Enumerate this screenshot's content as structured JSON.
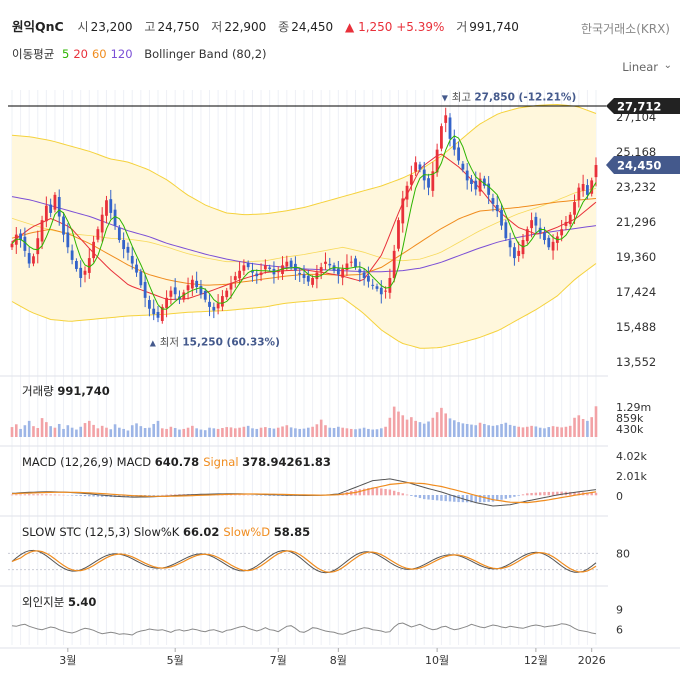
{
  "header": {
    "name": "원익QnC",
    "open_label": "시",
    "open": "23,200",
    "high_label": "고",
    "high": "24,750",
    "low_label": "저",
    "low": "22,900",
    "close_label": "종",
    "close": "24,450",
    "change": "▲ 1,250 +5.39%",
    "volume_label": "거",
    "volume": "991,740",
    "exchange": "한국거래소(KRX)",
    "scale": "Linear"
  },
  "indicators": {
    "ma_label": "이동평균",
    "ma_periods": [
      {
        "label": "5",
        "color": "#2db400"
      },
      {
        "label": "20",
        "color": "#e8303a"
      },
      {
        "label": "60",
        "color": "#f08c1e"
      },
      {
        "label": "120",
        "color": "#7b4fd6"
      }
    ],
    "bb_label": "Bollinger Band (80,2)"
  },
  "colors": {
    "up": "#e8303a",
    "down": "#3463c9",
    "bb_line": "#f5d23c",
    "bb_fill": "#fff7dc",
    "ma5": "#2db400",
    "ma20": "#e8303a",
    "ma60": "#f08c1e",
    "ma120": "#7b4fd6",
    "macd": "#555555",
    "signal": "#f08c1e",
    "stc_k": "#555555",
    "stc_d": "#f08c1e"
  },
  "chart_data": {
    "type": "line",
    "price_axis": {
      "ylim": [
        13552,
        28600
      ],
      "ticks": [
        13552,
        15488,
        17424,
        19360,
        21296,
        23232,
        25168,
        27104
      ],
      "tick_labels": [
        "13,552",
        "15,488",
        "17,424",
        "19,360",
        "21,296",
        "23,232",
        "25,168",
        "27,104"
      ]
    },
    "x_axis": {
      "ticks": [
        {
          "label": "3월",
          "index": 13
        },
        {
          "label": "5월",
          "index": 38
        },
        {
          "label": "7월",
          "index": 62
        },
        {
          "label": "8월",
          "index": 76
        },
        {
          "label": "10월",
          "index": 99
        },
        {
          "label": "12월",
          "index": 122
        },
        {
          "label": "2026",
          "index": 135
        }
      ]
    },
    "close_series": [
      20100,
      20600,
      20300,
      19700,
      19000,
      19400,
      20400,
      21400,
      22200,
      21800,
      22800,
      21600,
      20600,
      19900,
      19200,
      18700,
      18200,
      18600,
      19300,
      20200,
      20900,
      21700,
      22500,
      21800,
      21100,
      20300,
      19800,
      19600,
      19000,
      18500,
      17800,
      17100,
      16500,
      16200,
      16000,
      16600,
      17100,
      17500,
      17300,
      17000,
      17400,
      17800,
      18100,
      17700,
      17300,
      17000,
      16600,
      16400,
      16800,
      17200,
      17500,
      17900,
      18300,
      18600,
      18900,
      18800,
      18500,
      18300,
      18500,
      18900,
      18700,
      18400,
      18600,
      18900,
      19100,
      18800,
      18600,
      18400,
      18200,
      18000,
      18200,
      18500,
      18800,
      19100,
      18900,
      18600,
      18400,
      18700,
      19000,
      19100,
      18800,
      18500,
      18200,
      18000,
      17800,
      17600,
      17300,
      17500,
      18200,
      19700,
      21400,
      22600,
      23300,
      23900,
      24600,
      24200,
      23600,
      23200,
      24100,
      25300,
      26600,
      27200,
      25900,
      25300,
      24700,
      24200,
      23600,
      23400,
      23100,
      23700,
      23300,
      22800,
      22300,
      21900,
      21100,
      20400,
      19900,
      19300,
      19700,
      20300,
      20900,
      21400,
      21100,
      20700,
      20300,
      19900,
      20200,
      20500,
      20900,
      21300,
      21700,
      22400,
      23200,
      23400,
      22800,
      23600,
      24450
    ],
    "bb_upper": [
      26100,
      26000,
      25800,
      25500,
      25200,
      24800,
      24600,
      24200,
      23600,
      22800,
      22200,
      21800,
      21700,
      21750,
      21900,
      22100,
      22400,
      22700,
      23000,
      23300,
      23700,
      24200,
      24900,
      25800,
      26700,
      27300,
      27600,
      27750,
      27800,
      27700,
      27300
    ],
    "bb_lower": [
      16900,
      16300,
      15900,
      15800,
      15900,
      16000,
      16100,
      16150,
      16200,
      16300,
      16350,
      16400,
      16500,
      16600,
      16800,
      16900,
      17000,
      17100,
      16300,
      15300,
      14600,
      14300,
      14350,
      14600,
      14900,
      15300,
      15900,
      16500,
      17200,
      18200,
      19000
    ],
    "bb_mid": [
      21500,
      21150,
      20850,
      20650,
      20550,
      20400,
      20350,
      20200,
      19900,
      19550,
      19300,
      19100,
      19100,
      19150,
      19350,
      19500,
      19700,
      19900,
      19650,
      19300,
      19150,
      19250,
      19600,
      20200,
      20800,
      21300,
      21750,
      22100,
      22500,
      22950,
      23150
    ],
    "ma120": [
      22700,
      22500,
      22200,
      21900,
      21600,
      21200,
      20800,
      20500,
      20100,
      19800,
      19500,
      19250,
      19050,
      18900,
      18800,
      18700,
      18650,
      18600,
      18550,
      18550,
      18600,
      18750,
      19050,
      19450,
      19850,
      20200,
      20450,
      20650,
      20800,
      20950,
      21100
    ],
    "ma60": [
      20400,
      20700,
      20900,
      20600,
      20100,
      19500,
      18900,
      18400,
      18100,
      17900,
      17800,
      17850,
      18000,
      18150,
      18300,
      18400,
      18400,
      18350,
      18400,
      18800,
      19500,
      20200,
      20900,
      21500,
      21900,
      22000,
      22100,
      22250,
      22400,
      22500,
      22600
    ],
    "ma20": [
      20200,
      21000,
      21500,
      21000,
      19800,
      18700,
      17800,
      17400,
      17000,
      17050,
      17400,
      17800,
      18200,
      18500,
      18600,
      18650,
      18500,
      18300,
      18000,
      19500,
      22200,
      24300,
      25100,
      24300,
      23200,
      21900,
      21000,
      20600,
      21000,
      21500,
      22400
    ],
    "highs_lows": {
      "high": {
        "label": "최고",
        "value": "27,850 (-12.21%)",
        "price": 27850,
        "index": 101
      },
      "low": {
        "label": "최저",
        "value": "15,250 (60.33%)",
        "price": 15250,
        "index": 33
      }
    },
    "markers": [
      {
        "label": "27,712",
        "price": 27712,
        "role": "high-line"
      },
      {
        "label": "24,450",
        "price": 24450,
        "role": "last-price"
      }
    ],
    "volume_panel": {
      "title_label": "거래량",
      "title_value": "991,740",
      "ticks": [
        "1.29m",
        "859k",
        "430k"
      ],
      "values": [
        320,
        410,
        260,
        380,
        520,
        350,
        290,
        610,
        480,
        350,
        300,
        420,
        260,
        380,
        300,
        240,
        330,
        450,
        520,
        390,
        280,
        360,
        300,
        250,
        410,
        300,
        260,
        210,
        380,
        440,
        350,
        290,
        300,
        420,
        520,
        280,
        260,
        330,
        290,
        240,
        260,
        300,
        360,
        280,
        240,
        220,
        300,
        280,
        260,
        290,
        320,
        310,
        280,
        300,
        330,
        360,
        280,
        260,
        300,
        320,
        290,
        270,
        300,
        340,
        380,
        310,
        280,
        260,
        270,
        300,
        330,
        410,
        560,
        380,
        300,
        290,
        330,
        300,
        280,
        260,
        250,
        270,
        300,
        260,
        240,
        250,
        280,
        330,
        620,
        980,
        820,
        700,
        560,
        640,
        520,
        480,
        430,
        500,
        620,
        800,
        940,
        760,
        600,
        540,
        480,
        440,
        420,
        400,
        380,
        460,
        420,
        380,
        360,
        380,
        420,
        460,
        390,
        360,
        330,
        310,
        330,
        360,
        340,
        300,
        280,
        320,
        350,
        330,
        310,
        330,
        360,
        620,
        700,
        580,
        520,
        640,
        991
      ]
    },
    "macd_panel": {
      "title": "MACD (12,26,9)",
      "macd_label": "MACD",
      "macd_value": "640.78",
      "signal_label": "Signal",
      "signal_value": "378.94261.83",
      "ticks": [
        "4.02k",
        "2.01k",
        "0"
      ],
      "macd": [
        200,
        320,
        380,
        350,
        220,
        40,
        -150,
        -250,
        -230,
        -120,
        -10,
        80,
        130,
        150,
        110,
        40,
        -20,
        -60,
        -40,
        120,
        900,
        1700,
        1900,
        1500,
        900,
        350,
        -300,
        -900,
        -1300,
        -1150,
        -700,
        -300,
        100,
        380,
        640
      ],
      "signal": [
        150,
        230,
        300,
        330,
        300,
        200,
        60,
        -70,
        -150,
        -160,
        -110,
        -30,
        40,
        100,
        120,
        100,
        60,
        10,
        -20,
        30,
        300,
        800,
        1250,
        1450,
        1350,
        1000,
        500,
        -50,
        -550,
        -850,
        -900,
        -650,
        -300,
        50,
        379
      ]
    },
    "stc_panel": {
      "title": "SLOW STC (12,5,3)",
      "k_label": "Slow%K",
      "k_value": "66.02",
      "d_label": "Slow%D",
      "d_value": "58.85",
      "ticks": [
        "80"
      ]
    },
    "foreign_panel": {
      "title_label": "외인지분",
      "title_value": "5.40",
      "ticks": [
        "9",
        "6"
      ],
      "values": [
        6.6,
        6.5,
        6.7,
        6.8,
        6.5,
        6.3,
        6.1,
        6.0,
        6.2,
        6.4,
        6.3,
        6.0,
        5.8,
        5.6,
        5.5,
        5.7,
        6.0,
        6.2,
        6.1,
        5.9,
        5.6,
        5.4,
        5.5,
        5.6,
        5.5,
        5.3,
        5.4,
        5.3,
        5.2,
        5.6,
        5.8,
        5.9,
        6.1,
        6.0,
        5.9,
        6.0,
        5.8,
        5.6,
        5.9,
        6.0,
        5.8,
        5.9,
        6.1,
        6.0,
        5.8,
        5.7,
        5.9,
        6.0,
        5.8,
        5.6,
        5.9,
        6.0,
        6.2,
        6.4,
        6.5,
        6.2,
        6.0,
        5.8,
        6.0,
        6.3,
        6.0,
        5.9,
        5.7,
        6.1,
        6.5,
        6.6,
        6.2,
        5.7,
        5.6,
        5.9,
        6.3,
        6.2,
        6.0,
        5.8,
        5.7,
        5.6,
        5.4,
        5.3,
        5.5,
        5.8,
        5.9,
        6.1,
        6.3,
        6.2,
        6.0,
        5.9,
        5.8,
        5.6,
        5.7,
        6.4,
        6.9,
        7.0,
        6.7,
        6.4,
        6.6,
        6.8,
        6.5,
        6.2,
        6.0,
        6.1,
        6.4,
        6.5,
        6.2,
        6.0,
        6.1,
        6.3,
        6.5,
        6.8,
        6.6,
        6.4,
        6.3,
        6.5,
        6.7,
        6.6,
        6.4,
        6.3,
        6.5,
        6.4,
        6.3,
        6.2,
        6.4,
        6.6,
        6.7,
        6.6,
        6.4,
        6.5,
        6.6,
        6.7,
        6.9,
        6.8,
        6.6,
        6.2,
        5.9,
        5.8,
        5.7,
        5.5,
        5.4
      ]
    }
  }
}
